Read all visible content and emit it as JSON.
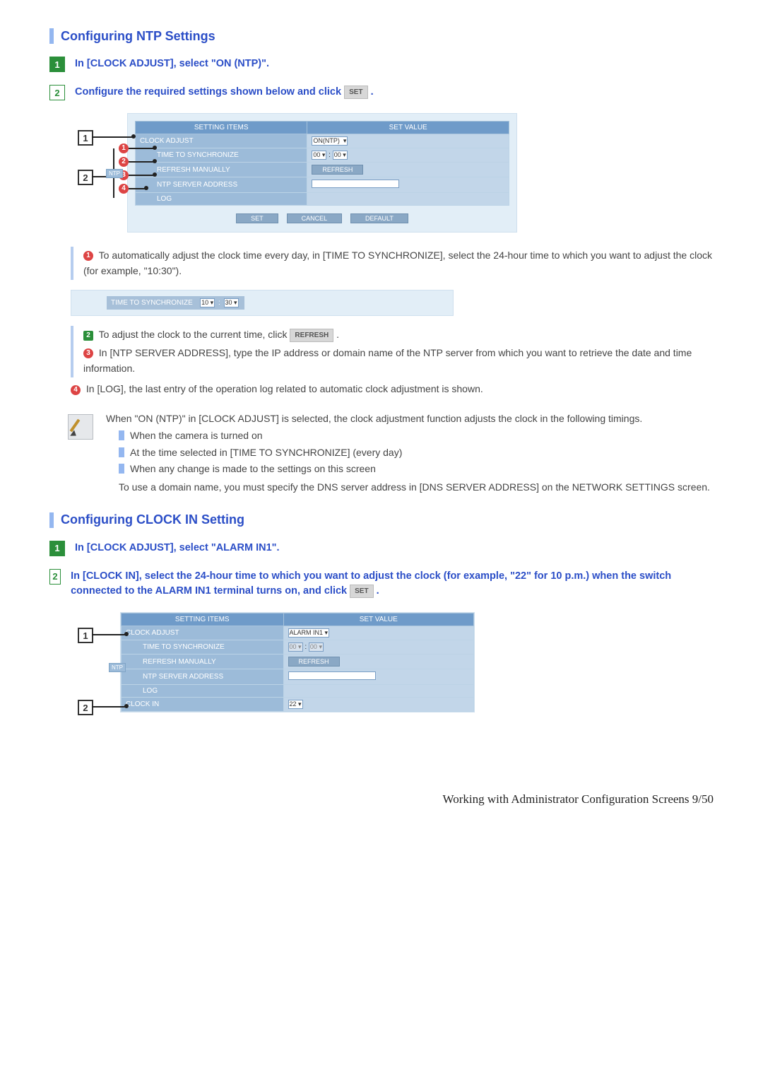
{
  "section1": {
    "title": "Configuring NTP Settings",
    "step1": "In [CLOCK ADJUST], select \"ON (NTP)\".",
    "step2_a": "Configure the required settings shown below and click ",
    "step2_btn": "SET",
    "step2_b": " ."
  },
  "shot1": {
    "h_items": "SETTING ITEMS",
    "h_value": "SET VALUE",
    "r_clock": "CLOCK ADJUST",
    "r_time": "TIME TO SYNCHRONIZE",
    "r_refresh": "REFRESH MANUALLY",
    "r_addr": "NTP SERVER ADDRESS",
    "r_log": "LOG",
    "ntp_badge": "NTP",
    "v_clock": "ON(NTP)",
    "v_time_h": "00",
    "v_time_m": "00",
    "sep": ":",
    "btn_refresh": "REFRESH",
    "btn_set": "SET",
    "btn_cancel": "CANCEL",
    "btn_default": "DEFAULT",
    "co1": "1",
    "co2": "2",
    "m1": "1",
    "m2": "2",
    "m3": "3",
    "m4": "4"
  },
  "desc": {
    "d1a": " To automatically adjust the clock time every day, in [TIME TO SYNCHRONIZE], select the 24-hour time to which you want to adjust the clock (for example, \"10:30\").",
    "tstrip_label": "TIME TO SYNCHRONIZE",
    "tstrip_h": "10",
    "tstrip_m": "30",
    "d2a": " To adjust the clock to the current time, click ",
    "d2btn": "REFRESH",
    "d2b": " .",
    "d3": " In [NTP SERVER ADDRESS], type the IP address or domain name of the NTP server from which you want to retrieve the date and time information.",
    "d4": " In [LOG], the last entry of the operation log related to automatic clock adjustment is shown.",
    "n1": "1",
    "n2": "2",
    "n3": "3",
    "n4": "4"
  },
  "note": {
    "line1": "When \"ON (NTP)\" in [CLOCK ADJUST] is selected, the clock adjustment function adjusts the clock in the following timings.",
    "b1": "When the camera is turned on",
    "b2": "At the time selected in [TIME TO SYNCHRONIZE] (every day)",
    "b3": "When any change is made to the settings on this screen",
    "line2": "To use a domain name, you must specify the DNS server address in [DNS SERVER ADDRESS] on the NETWORK SETTINGS screen."
  },
  "section2": {
    "title": "Configuring CLOCK IN Setting",
    "step1": "In [CLOCK ADJUST], select \"ALARM IN1\".",
    "step2_a": "In [CLOCK IN], select the 24-hour time to which you want to adjust the clock (for example, \"22\" for 10 p.m.) when the switch connected to the ALARM IN1 terminal turns on, and click ",
    "step2_btn": "SET",
    "step2_b": " ."
  },
  "shot2": {
    "h_items": "SETTING ITEMS",
    "h_value": "SET VALUE",
    "r_clock": "CLOCK ADJUST",
    "r_time": "TIME TO SYNCHRONIZE",
    "r_refresh": "REFRESH MANUALLY",
    "r_addr": "NTP SERVER ADDRESS",
    "r_log": "LOG",
    "r_clockin": "CLOCK IN",
    "ntp_badge": "NTP",
    "v_clock": "ALARM IN1",
    "v_time_h": "00",
    "v_time_m": "00",
    "btn_refresh": "REFRESH",
    "v_clockin": "22",
    "co1": "1",
    "co2": "2"
  },
  "footer": "Working with Administrator Configuration Screens 9/50"
}
